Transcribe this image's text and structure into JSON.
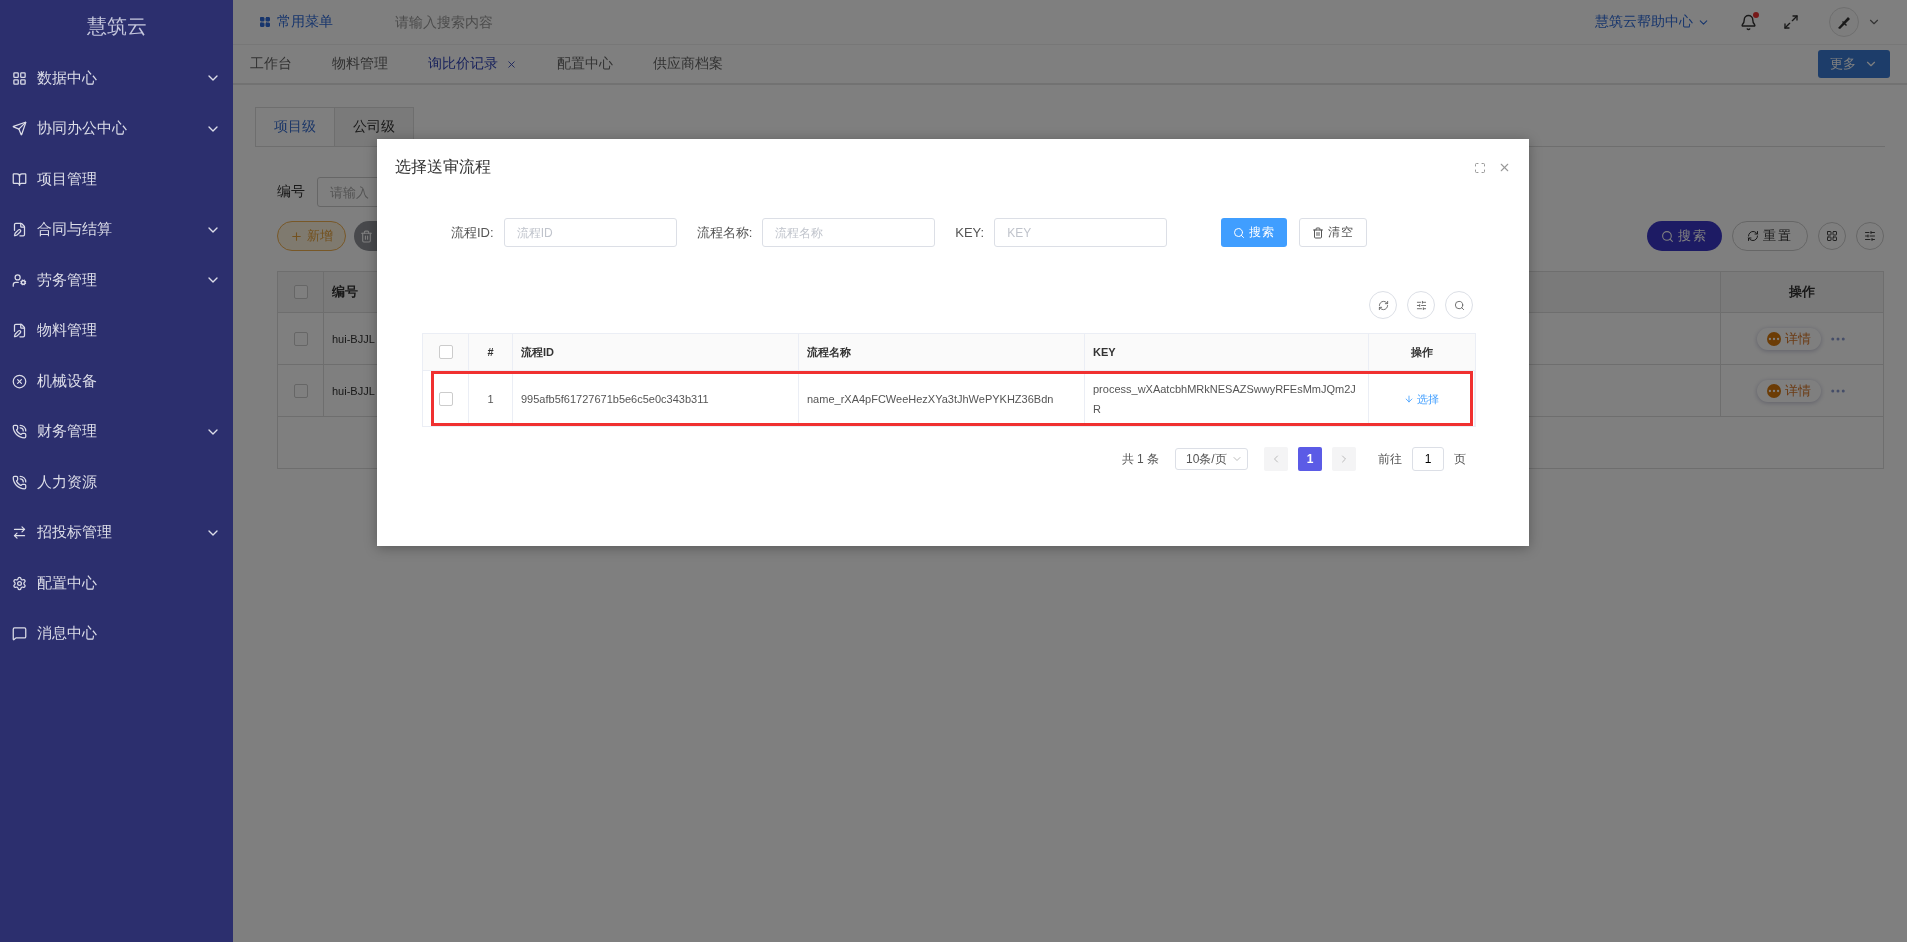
{
  "sidebar": {
    "logo": "慧筑云",
    "items": [
      {
        "label": "数据中心",
        "expandable": true
      },
      {
        "label": "协同办公中心",
        "expandable": true
      },
      {
        "label": "项目管理",
        "expandable": false
      },
      {
        "label": "合同与结算",
        "expandable": true
      },
      {
        "label": "劳务管理",
        "expandable": true
      },
      {
        "label": "物料管理",
        "expandable": false
      },
      {
        "label": "机械设备",
        "expandable": false
      },
      {
        "label": "财务管理",
        "expandable": true
      },
      {
        "label": "人力资源",
        "expandable": false
      },
      {
        "label": "招投标管理",
        "expandable": true
      },
      {
        "label": "配置中心",
        "expandable": false
      },
      {
        "label": "消息中心",
        "expandable": false
      }
    ]
  },
  "topbar": {
    "menu_label": "常用菜单",
    "search": {
      "placeholder": "请输入搜索内容"
    },
    "help": "慧筑云帮助中心",
    "has_unread": true
  },
  "tabs": [
    {
      "label": "工作台",
      "selected": false,
      "closable": false
    },
    {
      "label": "物料管理",
      "selected": false,
      "closable": false
    },
    {
      "label": "询比价记录",
      "selected": true,
      "closable": true
    },
    {
      "label": "配置中心",
      "selected": false,
      "closable": false
    },
    {
      "label": "供应商档案",
      "selected": false,
      "closable": false
    }
  ],
  "more_button": "更多",
  "page": {
    "level_tabs": [
      {
        "label": "项目级",
        "selected": true
      },
      {
        "label": "公司级",
        "selected": false
      }
    ],
    "filter": {
      "label": "编号",
      "placeholder": "请输入"
    },
    "add_button": "新增",
    "search_button": "搜索",
    "reset_button": "重置",
    "table": {
      "columns": [
        "编号",
        "操作"
      ],
      "all_checked": false,
      "rows": [
        {
          "code": "hui-BJJL",
          "action": "详情",
          "checked": false
        },
        {
          "code": "hui-BJJL",
          "action": "详情",
          "checked": false
        }
      ]
    }
  },
  "dialog": {
    "title": "选择送审流程",
    "fields": [
      {
        "label": "流程ID:",
        "placeholder": "流程ID"
      },
      {
        "label": "流程名称:",
        "placeholder": "流程名称"
      },
      {
        "label": "KEY:",
        "placeholder": "KEY"
      }
    ],
    "search_button": "搜索",
    "clear_button": "清空",
    "table": {
      "columns": [
        "#",
        "流程ID",
        "流程名称",
        "KEY",
        "操作"
      ],
      "all_checked": false,
      "rows": [
        {
          "index": "1",
          "id": "995afb5f61727671b5e6c5e0c343b311",
          "name": "name_rXA4pFCWeeHezXYa3tJhWePYKHZ36Bdn",
          "key": "process_wXAatcbhMRkNESAZSwwyRFEsMmJQm2JR",
          "action": "选择",
          "checked": false,
          "highlighted": true
        }
      ]
    },
    "pagination": {
      "total": "共 1 条",
      "page_size": "10条/页",
      "pages": [
        {
          "label": "1",
          "selected": true
        }
      ],
      "goto_label": "前往",
      "goto_value": "1",
      "goto_suffix": "页"
    }
  }
}
